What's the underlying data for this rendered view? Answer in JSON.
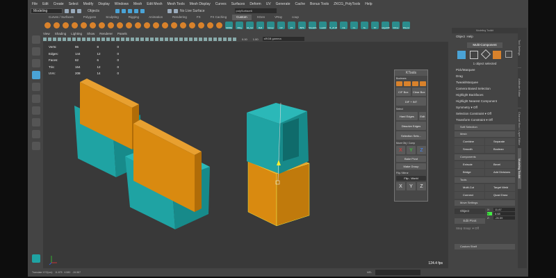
{
  "menu": [
    "File",
    "Edit",
    "Create",
    "Select",
    "Modify",
    "Display",
    "Windows",
    "Mesh",
    "Edit Mesh",
    "Mesh Tools",
    "Mesh Display",
    "Curves",
    "Surfaces",
    "Deform",
    "UV",
    "Generate",
    "Cache",
    "Bonus Tools",
    "ZKCG_PolyTools",
    "Help"
  ],
  "toolbar": {
    "mode": "Modeling",
    "objects": "Objects",
    "live_surface": "No Live Surface",
    "search": "polySurface6"
  },
  "shelf_tabs": [
    "Curves / Surfaces",
    "Polygons",
    "Sculpting",
    "Rigging",
    "Animation",
    "Rendering",
    "FX",
    "FX Caching",
    "Custom",
    "XGen",
    "VRay",
    "coup"
  ],
  "shelf_labels": [
    "MRRE",
    "XRig",
    "Hit_fun",
    "Refl",
    "Group",
    "CP",
    "PT",
    "BPS",
    "ShowMo",
    "LookD",
    "R_v0.30",
    "CE",
    "CL",
    "SL",
    "TP",
    "edgeDIR",
    "DOne",
    "DNorm"
  ],
  "panel_menu": [
    "View",
    "Shading",
    "Lighting",
    "Show",
    "Renderer",
    "Panels"
  ],
  "viewport": {
    "val1": "0.00",
    "val2": "1.00",
    "colorspace": "sRGB gamma",
    "fps": "124.4 fps"
  },
  "stats": [
    [
      "Verts:",
      "96",
      "8",
      "0"
    ],
    [
      "Edges:",
      "144",
      "12",
      "0"
    ],
    [
      "Faces:",
      "62",
      "6",
      "0"
    ],
    [
      "Tris:",
      "164",
      "12",
      "0"
    ],
    [
      "UVs:",
      "208",
      "14",
      "0"
    ]
  ],
  "ktools": {
    "title": "KTools",
    "s1": "Booleans",
    "cutbox": "C/F Box",
    "clearbox": "Clear Box",
    "dif": "DIF + INT",
    "s2": "Select",
    "hard": "Hard Edges",
    "edit": "Edit",
    "dissolve": "Dissolve Edges",
    "selsets": "Selection Sets...",
    "s3": "Move Obj / Comp",
    "x": "X",
    "y": "Y",
    "z": "Z",
    "bake": "Bake Pivot",
    "group": "Make Group",
    "s4": "Flip / Mirror",
    "flip": "Flip - World"
  },
  "right": {
    "title": "Modeling Toolkit",
    "menu": [
      "Object",
      "Help"
    ],
    "mode": "Multi-Component",
    "selected": "1 object selected",
    "pick": "Pick/Marquee",
    "drag": "Drag",
    "tweak": "Tweak/Marquee",
    "camera": "Camera Based Selection",
    "backfaces": "Highlight Backfaces",
    "nearest": "Highlight Nearest Component",
    "symmetry": "Symmetry",
    "sym_val": "Off",
    "sel_con": "Selection Constraint",
    "sel_con_val": "Off",
    "tr_con": "Transform Constraint",
    "tr_con_val": "Off",
    "soft": "Soft Selection",
    "mesh": "Mesh",
    "mesh_items": [
      "Combine",
      "Separate",
      "Smooth",
      "Boolean"
    ],
    "comp": "Components",
    "comp_items": [
      "Extrude",
      "Bevel",
      "Bridge",
      "Add Divisions"
    ],
    "tools": "Tools",
    "tool_items": [
      "Multi-Cut",
      "Target Weld",
      "Connect",
      "Quad Draw"
    ],
    "move": "Move Settings",
    "object": "Object",
    "edit_pivot": "Edit Pivot",
    "xv": "11.87",
    "yv": "6.68",
    "zv": "-26.59",
    "xl": "X:",
    "yl": "Y:",
    "zl": "Z:",
    "step": "Step Snap:",
    "step_val": "Off",
    "custom": "Custom Shelf"
  },
  "vtabs": [
    "Tool Settings",
    "Attribute Editor",
    "Channel Box / Layer Editor",
    "Modeling Toolkit"
  ],
  "status": {
    "label": "Translate XYZ(cm):",
    "x": "11.875",
    "y": "6.580",
    "z": "-26.587",
    "mel": "MEL"
  },
  "colors": {
    "teal": "#1fa3a3",
    "orange": "#d98a10",
    "accent": "#4aa3d6"
  }
}
